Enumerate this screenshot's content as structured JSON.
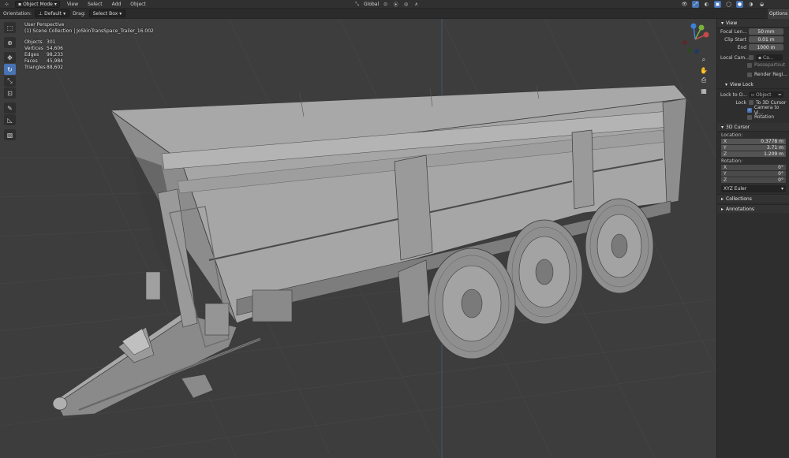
{
  "header": {
    "mode": "Object Mode",
    "menus": [
      "View",
      "Select",
      "Add",
      "Object"
    ],
    "transform_orientation": "Global"
  },
  "tool_header": {
    "orientation_label": "Orientation:",
    "orientation_value": "Default",
    "drag_label": "Drag:",
    "drag_value": "Select Box",
    "options_label": "Options"
  },
  "viewport": {
    "perspective": "User Perspective",
    "collection": "(1) Scene Collection | JoSkinTransSpace_Trailer_16.002",
    "stats": [
      {
        "label": "Objects",
        "value": "301"
      },
      {
        "label": "Vertices",
        "value": "54,606"
      },
      {
        "label": "Edges",
        "value": "98,233"
      },
      {
        "label": "Faces",
        "value": "45,984"
      },
      {
        "label": "Triangles",
        "value": "88,602"
      }
    ],
    "background_color": "#3d3d3d"
  },
  "toolbar": {
    "icons": [
      "select-box-icon",
      "cursor-icon",
      "move-icon",
      "rotate-icon",
      "scale-icon",
      "transform-icon",
      "annotate-icon",
      "measure-icon",
      "add-cube-icon"
    ],
    "active": "rotate-icon"
  },
  "sidebar": {
    "view_title": "View",
    "focal_length_label": "Focal Len...",
    "focal_length": "50 mm",
    "clip_start_label": "Clip Start",
    "clip_start": "0.01 m",
    "end_label": "End",
    "end": "1000 m",
    "local_camera_label": "Local Cam...",
    "local_camera_value": "Ca...",
    "passepartout_label": "Passepartout",
    "render_region_label": "Render Regi...",
    "view_lock_title": "View Lock",
    "lock_to_object_label": "Lock to O...",
    "lock_to_object_placeholder": "Object",
    "lock_label": "Lock",
    "to_3d_cursor_label": "To 3D Cursor",
    "camera_to_view_label": "Camera to Vi...",
    "rotation_lock_label": "Rotation",
    "cursor_title": "3D Cursor",
    "location_label": "Location:",
    "location": [
      {
        "axis": "X",
        "value": "0.3778 m"
      },
      {
        "axis": "Y",
        "value": "3.71 m"
      },
      {
        "axis": "Z",
        "value": "1.209 m"
      }
    ],
    "rotation_label": "Rotation:",
    "rotation": [
      {
        "axis": "X",
        "value": "0°"
      },
      {
        "axis": "Y",
        "value": "0°"
      },
      {
        "axis": "Z",
        "value": "0°"
      }
    ],
    "rotation_mode": "XYZ Euler",
    "collections_title": "Collections",
    "annotations_title": "Annotations"
  },
  "colors": {
    "accent": "#4772b3",
    "axis_x": "#c44a4a",
    "axis_y": "#7bb33a",
    "axis_z": "#3e7fd8"
  }
}
